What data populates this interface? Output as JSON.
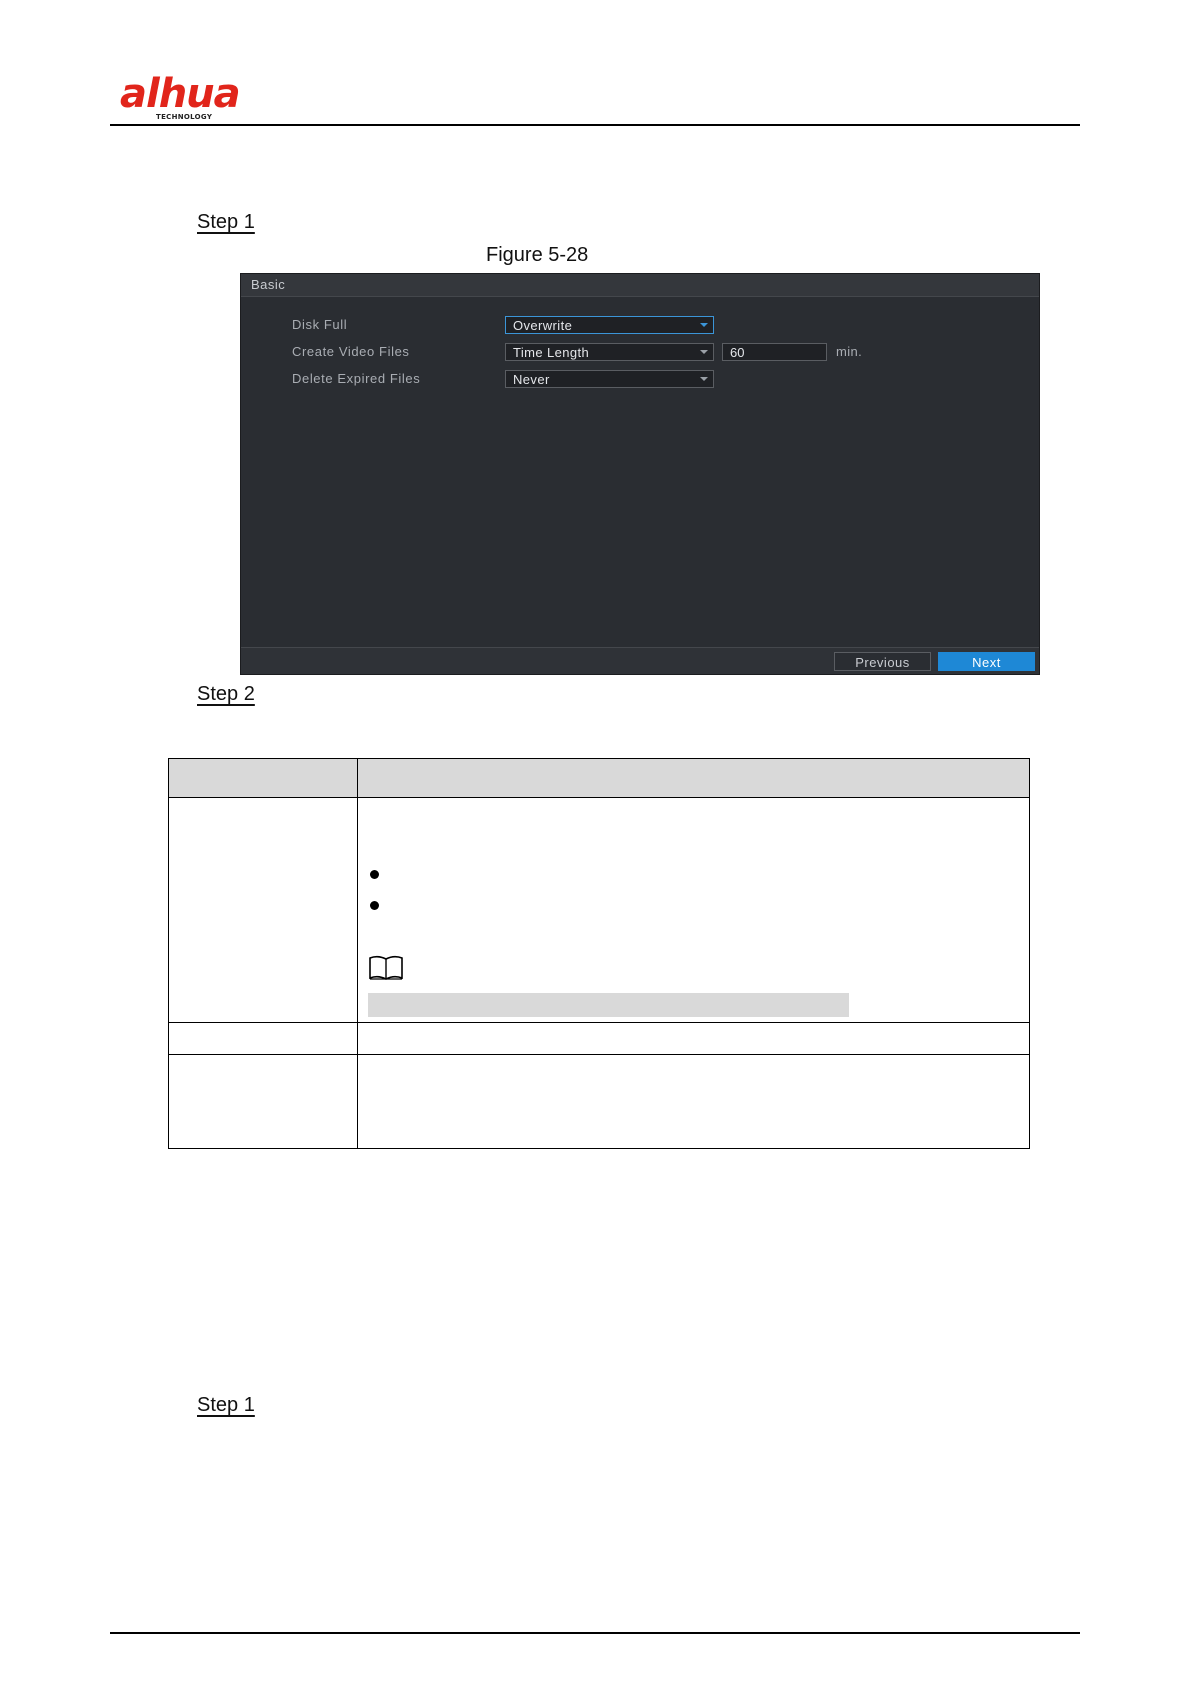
{
  "header": {
    "brand": "alhua",
    "brand_sub": "TECHNOLOGY"
  },
  "steps": {
    "step1_a": "Step 1",
    "step2": "Step 2",
    "step1_b": "Step 1"
  },
  "figure": {
    "caption": "Figure 5-28"
  },
  "panel": {
    "title": "Basic",
    "rows": [
      {
        "label": "Disk Full",
        "value": "Overwrite"
      },
      {
        "label": "Create Video Files",
        "value": "Time Length",
        "input_value": "60",
        "unit": "min."
      },
      {
        "label": "Delete Expired Files",
        "value": "Never"
      }
    ],
    "previous_label": "Previous",
    "next_label": "Next"
  },
  "colors": {
    "panel_bg": "#2a2d32",
    "accent": "#1e88d6",
    "brand_red": "#e1251b",
    "table_header": "#d9d9d9"
  },
  "icons": {
    "note": "book-icon"
  }
}
